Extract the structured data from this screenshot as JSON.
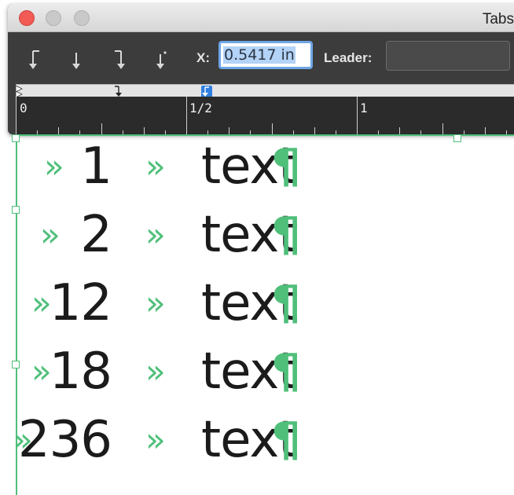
{
  "window": {
    "title": "Tabs",
    "x_label": "X:",
    "x_value": "0.5417 in",
    "leader_label": "Leader:",
    "leader_value": ""
  },
  "ruler": {
    "labels": [
      "0",
      "1/2",
      "1"
    ]
  },
  "document": {
    "rows": [
      {
        "number": "1",
        "text": "text"
      },
      {
        "number": "2",
        "text": "text"
      },
      {
        "number": "12",
        "text": "text"
      },
      {
        "number": "18",
        "text": "text"
      },
      {
        "number": "236",
        "text": "text"
      }
    ],
    "tab_glyph": "»",
    "paragraph_mark": "¶"
  },
  "colors": {
    "guide_green": "#4fbf7a",
    "selection_blue": "#b3d3f7",
    "focus_ring": "#6fa6e6"
  },
  "icons": {
    "align_buttons": [
      "left-align-tab-icon",
      "center-align-tab-icon",
      "right-align-tab-icon",
      "decimal-align-tab-icon"
    ]
  }
}
